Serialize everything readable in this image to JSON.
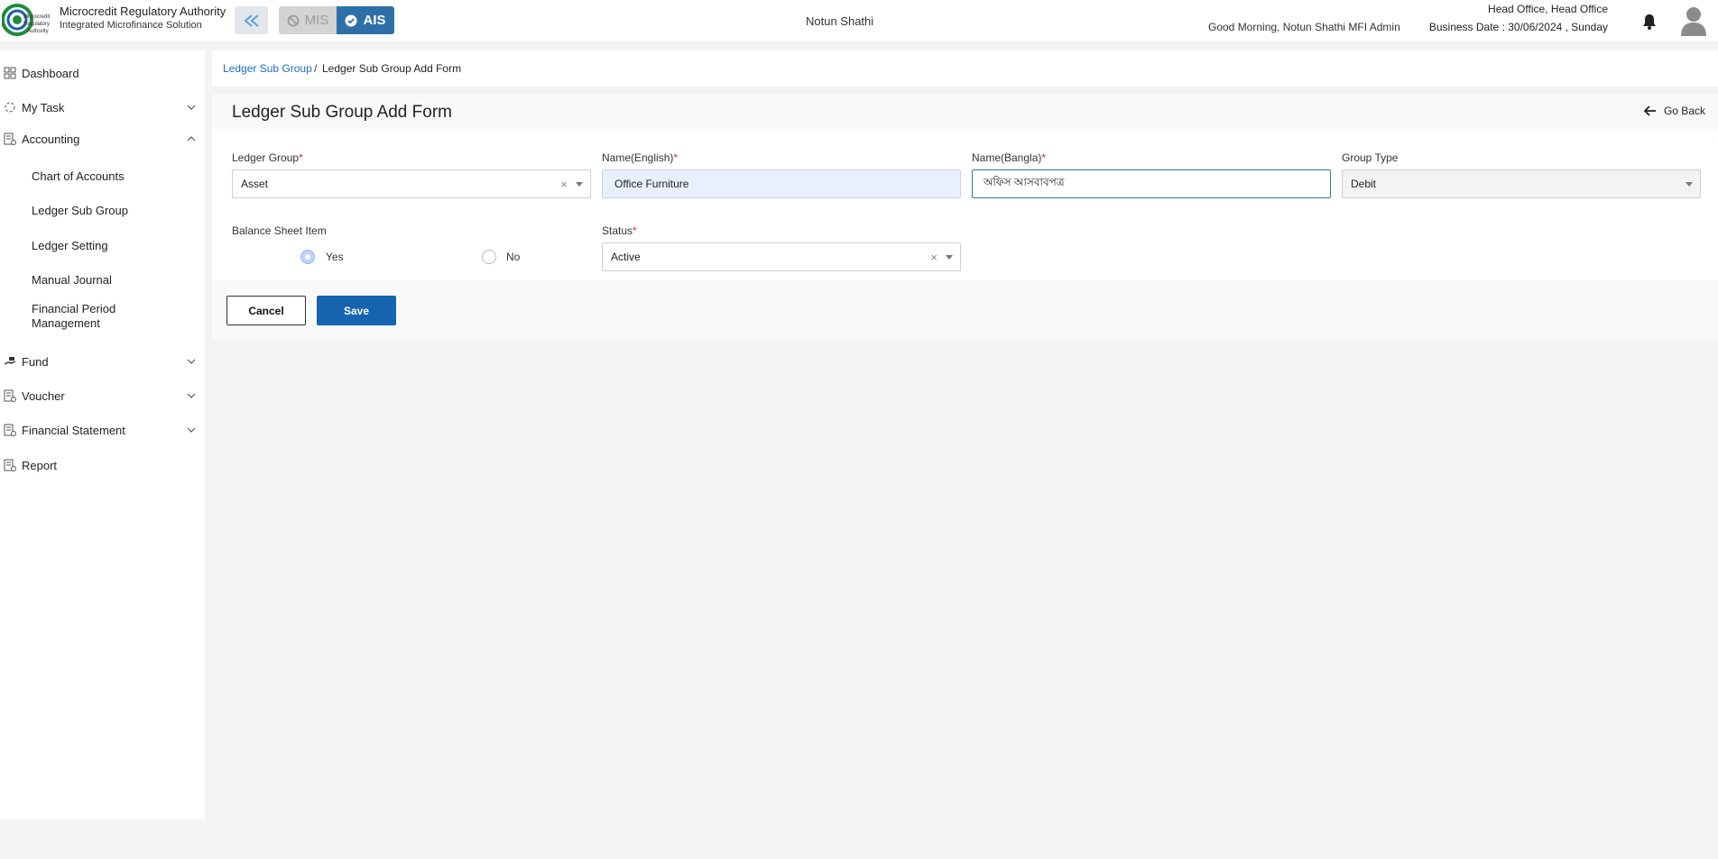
{
  "header": {
    "logo_text": "Microcredit Regulatory Authority",
    "brand_title": "Microcredit Regulatory Authority",
    "brand_subtitle": "Integrated Microfinance Solution",
    "module_mis": "MIS",
    "module_ais": "AIS",
    "org_name": "Notun Shathi",
    "greeting": "Good Morning, Notun Shathi MFI Admin",
    "office": "Head Office, Head Office",
    "business_date": "Business Date : 30/06/2024 , Sunday"
  },
  "sidebar": {
    "items": [
      {
        "label": "Dashboard",
        "icon": "grid-icon"
      },
      {
        "label": "My Task",
        "icon": "task-icon"
      },
      {
        "label": "Accounting",
        "icon": "ledger-icon"
      },
      {
        "label": "Fund",
        "icon": "hand-money-icon"
      },
      {
        "label": "Voucher",
        "icon": "ledger-icon"
      },
      {
        "label": "Financial Statement",
        "icon": "ledger-icon"
      },
      {
        "label": "Report",
        "icon": "ledger-icon"
      }
    ],
    "accounting_sub": [
      "Chart of Accounts",
      "Ledger Sub Group",
      "Ledger Setting",
      "Manual Journal",
      "Financial Period Management"
    ]
  },
  "breadcrumb": {
    "parent": "Ledger Sub Group",
    "separator": "/",
    "current": "Ledger Sub Group Add Form"
  },
  "form": {
    "title": "Ledger Sub Group Add Form",
    "go_back": "Go Back",
    "ledger_group": {
      "label": "Ledger Group",
      "value": "Asset"
    },
    "name_english": {
      "label": "Name(English)",
      "value": "Office Furniture"
    },
    "name_bangla": {
      "label": "Name(Bangla)",
      "value": "অফিস আসবাবপত্র"
    },
    "group_type": {
      "label": "Group Type",
      "value": "Debit"
    },
    "balance_sheet": {
      "label": "Balance Sheet Item",
      "yes": "Yes",
      "no": "No",
      "selected": "Yes"
    },
    "status": {
      "label": "Status",
      "value": "Active"
    },
    "required_mark": "*",
    "clear_mark": "×",
    "cancel": "Cancel",
    "save": "Save"
  },
  "colors": {
    "primary": "#1663b0",
    "link": "#1b6ec2",
    "required": "#d32f2f",
    "ais_module": "#2f6fa7"
  }
}
